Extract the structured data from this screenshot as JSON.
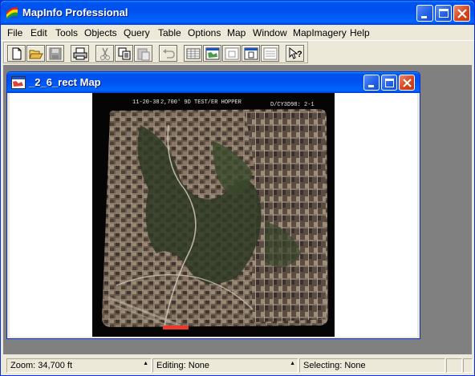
{
  "app": {
    "title": "MapInfo Professional"
  },
  "menu": {
    "items": [
      "File",
      "Edit",
      "Tools",
      "Objects",
      "Query",
      "Table",
      "Options",
      "Map",
      "Window",
      "MapImagery",
      "Help"
    ]
  },
  "toolbar": {
    "buttons": [
      "new-icon",
      "open-icon",
      "save-icon",
      "print-icon",
      "cut-icon",
      "copy-icon",
      "paste-icon",
      "undo-icon",
      "new-browser-icon",
      "new-mapper-icon",
      "new-grapher-icon",
      "new-layout-icon",
      "new-redistrict-icon",
      "help-pointer-icon"
    ]
  },
  "map_window": {
    "title": "_2_6_rect Map",
    "image_annotations": {
      "left": "11-20-38",
      "center": "2,700' 9D TEST/ER HOPPER",
      "right": "D/CY3D98: 2-1"
    },
    "scale_bar_color": "#e8392a"
  },
  "status": {
    "zoom": "Zoom: 34,700 ft",
    "editing": "Editing: None",
    "selecting": "Selecting: None"
  },
  "colors": {
    "titlebar": "#0054e3",
    "chrome": "#ece9d8",
    "mdi_background": "#808080",
    "close_button": "#d9441c"
  }
}
